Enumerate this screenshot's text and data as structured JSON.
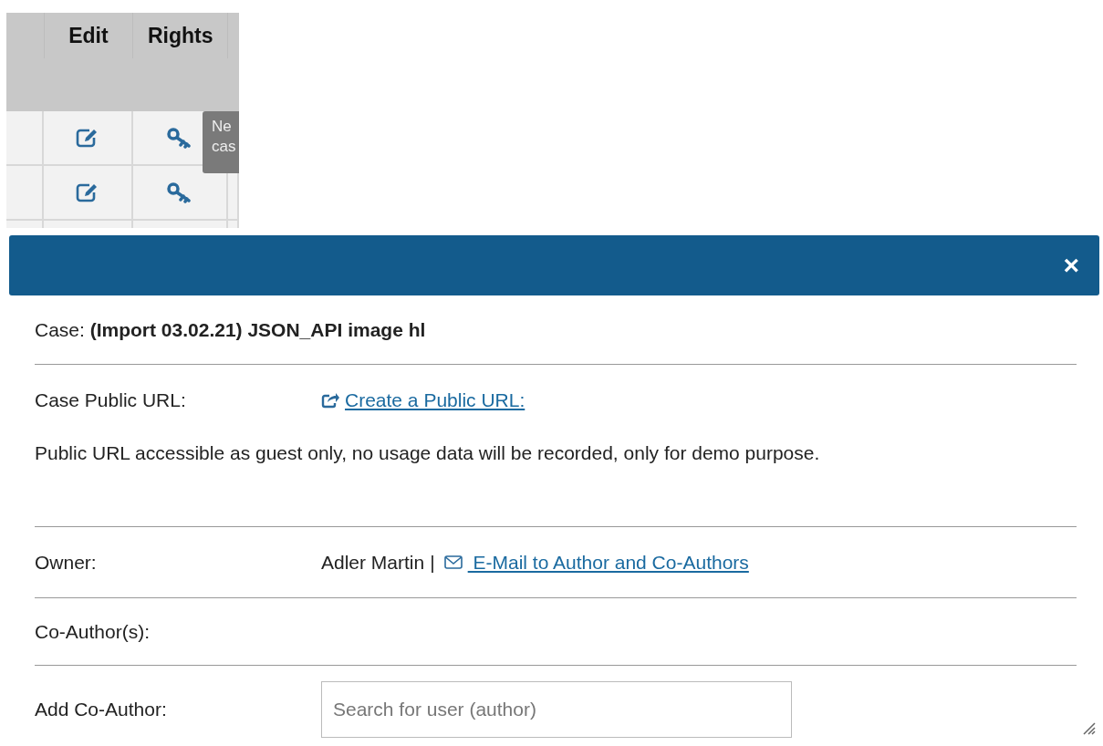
{
  "table": {
    "columns": [
      "",
      "Edit",
      "Rights"
    ],
    "rows": [
      {
        "kind": "actions"
      },
      {
        "kind": "actions"
      }
    ],
    "tooltip": {
      "lines": [
        "Ne",
        "cas"
      ]
    }
  },
  "dialog": {
    "close": "×",
    "case_label": "Case:",
    "case_title": "(Import 03.02.21) JSON_API image hl",
    "public_url_label": "Case Public URL:",
    "public_url_link": "Create a Public URL:",
    "public_url_note": "Public URL accessible as guest only, no usage data will be recorded, only for demo purpose.",
    "owner_label": "Owner:",
    "owner_name": "Adler Martin",
    "owner_separator": "|",
    "email_link": " E-Mail to Author and Co-Authors",
    "coauthors_label": "Co-Author(s):",
    "add_coauthor_label": "Add Co-Author:",
    "add_coauthor_placeholder": "Search for user (author)"
  }
}
